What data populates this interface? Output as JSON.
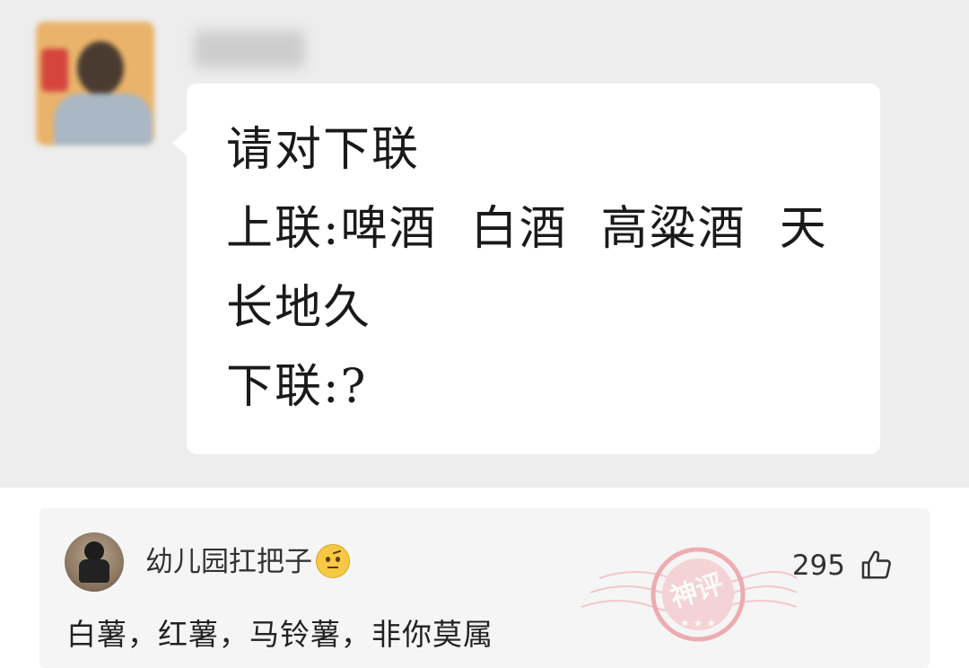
{
  "chat": {
    "message_lines": [
      "请对下联",
      "上联:啤酒  白酒  高粱酒  天",
      "长地久",
      "下联:?"
    ]
  },
  "comment": {
    "username": "幼儿园扛把子",
    "emoji": "raised-eyebrow-face-icon",
    "likes": "295",
    "text": "白薯，红薯，马铃薯，非你莫属",
    "badge_text": "神评"
  },
  "colors": {
    "chat_background": "#ededed",
    "bubble": "#ffffff",
    "comment_card": "#f5f5f5",
    "stamp": "#e8727a"
  }
}
